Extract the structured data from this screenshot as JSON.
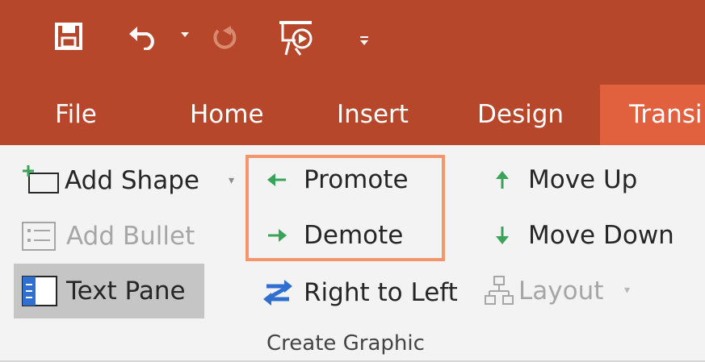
{
  "colors": {
    "title_bar": "#b7472a",
    "active_tab": "#e1603d",
    "ribbon_bg": "#f3f3f3",
    "highlight_border": "#f5956a",
    "arrow_green": "#3aa35a",
    "arrow_blue": "#2f6fcf"
  },
  "quick_access": {
    "save_icon": "save-icon",
    "undo_icon": "undo-icon",
    "redo_icon": "redo-icon",
    "slideshow_icon": "from-beginning-icon",
    "customize_icon": "customize-qat-icon"
  },
  "tabs": [
    {
      "label": "File"
    },
    {
      "label": "Home"
    },
    {
      "label": "Insert"
    },
    {
      "label": "Design"
    },
    {
      "label": "Transi"
    }
  ],
  "ribbon": {
    "add_shape": "Add Shape",
    "add_bullet": "Add Bullet",
    "text_pane": "Text Pane",
    "promote": "Promote",
    "demote": "Demote",
    "right_to_left": "Right to Left",
    "move_up": "Move Up",
    "move_down": "Move Down",
    "layout": "Layout",
    "group_label": "Create Graphic"
  }
}
